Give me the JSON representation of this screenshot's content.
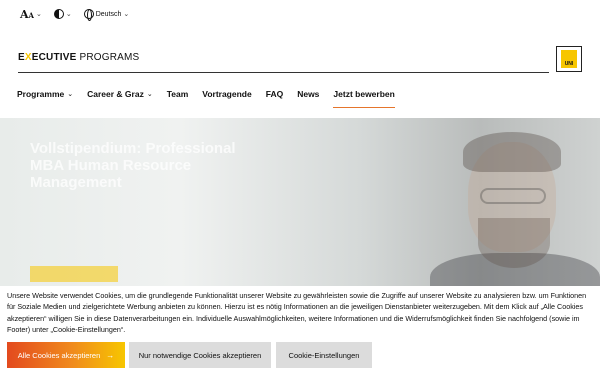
{
  "utility": {
    "font_size_label": "A",
    "font_size_small": "A",
    "language": "Deutsch"
  },
  "brand": {
    "prefix": "E",
    "x": "X",
    "rest_bold": "ECUTIVE",
    "programs": " PROGRAMS",
    "logo_text_1": "UNI",
    "logo_text_2": "GRAZ"
  },
  "nav": {
    "items": [
      {
        "label": "Programme",
        "has_dropdown": true
      },
      {
        "label": "Career & Graz",
        "has_dropdown": true
      },
      {
        "label": "Team",
        "has_dropdown": false
      },
      {
        "label": "Vortragende",
        "has_dropdown": false
      },
      {
        "label": "FAQ",
        "has_dropdown": false
      },
      {
        "label": "News",
        "has_dropdown": false
      },
      {
        "label": "Jetzt bewerben",
        "has_dropdown": false,
        "active": true
      }
    ]
  },
  "hero": {
    "title": "Vollstipendium: Professional MBA Human Resource Management",
    "text": "",
    "button": ""
  },
  "cookie": {
    "text": "Unsere Website verwendet Cookies, um die grundlegende Funktionalität unserer Website zu gewährleisten sowie die Zugriffe auf unserer Website zu analysieren bzw. um Funktionen für Soziale Medien und zielgerichtete Werbung anbieten zu können. Hierzu ist es nötig Informationen an die jeweiligen Dienstanbieter weiterzugeben. Mit dem Klick auf „Alle Cookies akzeptieren“ willigen Sie in diese Datenverarbeitungen ein. Individuelle Auswahlmöglichkeiten, weitere Informationen und die Widerrufsmöglichkeit finden Sie nachfolgend (sowie im Footer) unter „Cookie-Einstellungen“.",
    "accept_all": "Alle Cookies akzeptieren",
    "necessary_only": "Nur notwendige Cookies akzeptieren",
    "settings": "Cookie-Einstellungen"
  },
  "colors": {
    "accent": "#e5752c",
    "brand_yellow": "#f7c600",
    "accept_gradient_start": "#e34a1e"
  }
}
